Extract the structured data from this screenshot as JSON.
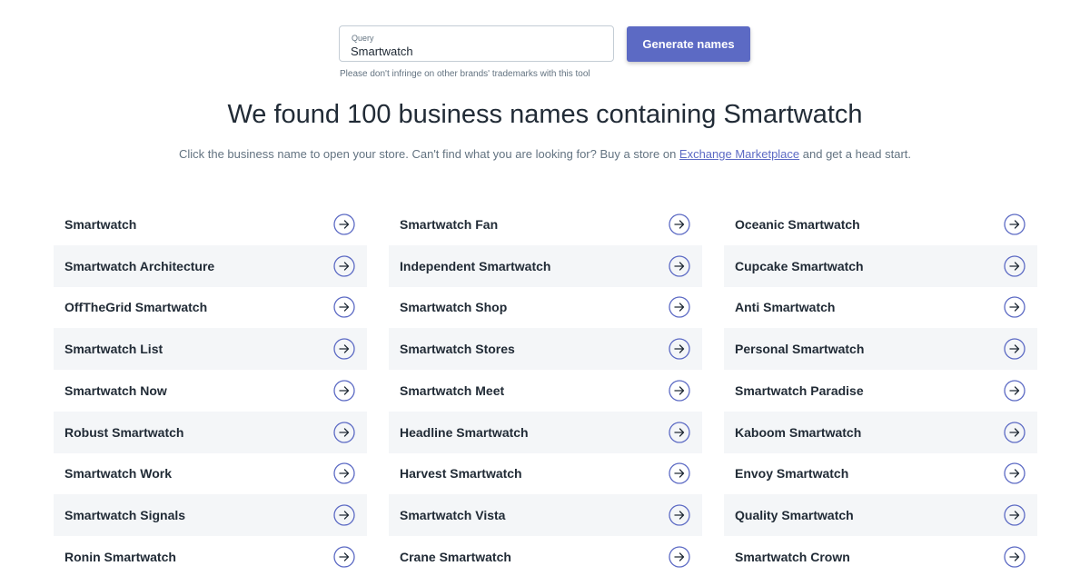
{
  "search": {
    "label": "Query",
    "value": "Smartwatch",
    "button_label": "Generate names",
    "hint": "Please don't infringe on other brands' trademarks with this tool"
  },
  "results": {
    "headline": "We found 100 business names containing Smartwatch",
    "subline_before": "Click the business name to open your store. Can't find what you are looking for? Buy a store on ",
    "subline_link": "Exchange Marketplace",
    "subline_after": " and get a head start."
  },
  "names": [
    "Smartwatch",
    "Smartwatch Fan",
    "Oceanic Smartwatch",
    "Smartwatch Architecture",
    "Independent Smartwatch",
    "Cupcake Smartwatch",
    "OffTheGrid Smartwatch",
    "Smartwatch Shop",
    "Anti Smartwatch",
    "Smartwatch List",
    "Smartwatch Stores",
    "Personal Smartwatch",
    "Smartwatch Now",
    "Smartwatch Meet",
    "Smartwatch Paradise",
    "Robust Smartwatch",
    "Headline Smartwatch",
    "Kaboom Smartwatch",
    "Smartwatch Work",
    "Harvest Smartwatch",
    "Envoy Smartwatch",
    "Smartwatch Signals",
    "Smartwatch Vista",
    "Quality Smartwatch",
    "Ronin Smartwatch",
    "Crane Smartwatch",
    "Smartwatch Crown"
  ],
  "icons": {
    "row_action": "arrow-right-circle-icon"
  },
  "colors": {
    "accent": "#5c6ac4",
    "shaded_row": "#f4f6f8",
    "text": "#212b36",
    "muted": "#637381"
  }
}
